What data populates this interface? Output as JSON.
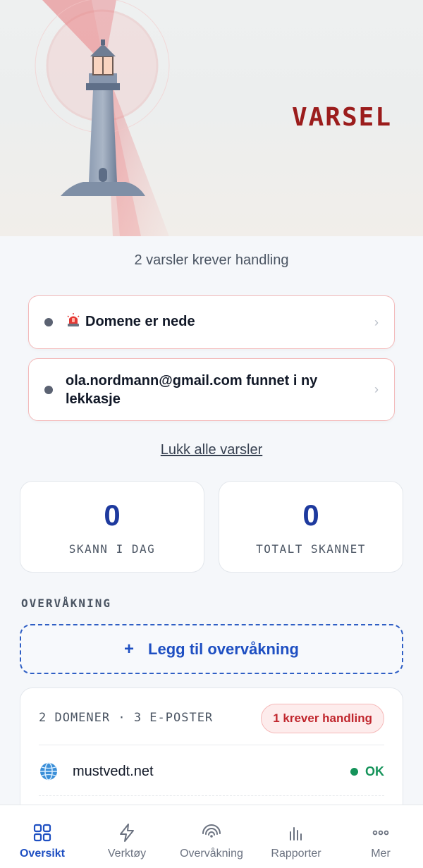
{
  "hero": {
    "title": "VARSEL"
  },
  "alerts": {
    "summary": "2 varsler krever handling",
    "items": [
      {
        "text": "Domene er nede",
        "icon": "siren-icon"
      },
      {
        "text": "ola.nordmann@gmail.com funnet i ny lekkasje"
      }
    ],
    "close_all": "Lukk alle varsler"
  },
  "stats": [
    {
      "value": "0",
      "label": "SKANN I DAG"
    },
    {
      "value": "0",
      "label": "TOTALT SKANNET"
    }
  ],
  "monitoring": {
    "section_label": "OVERVÅKNING",
    "add_button": "Legg til overvåkning",
    "add_icon": "+",
    "summary": "2 DOMENER · 3 E-POSTER",
    "badge": "1 krever handling",
    "rows": [
      {
        "domain": "mustvedt.net",
        "status": "OK"
      }
    ]
  },
  "nav": {
    "items": [
      {
        "label": "Oversikt",
        "icon": "grid-icon"
      },
      {
        "label": "Verktøy",
        "icon": "bolt-icon"
      },
      {
        "label": "Overvåkning",
        "icon": "radar-icon"
      },
      {
        "label": "Rapporter",
        "icon": "bar-chart-icon"
      },
      {
        "label": "Mer",
        "icon": "more-icon"
      }
    ]
  },
  "colors": {
    "accent": "#1e4fc2",
    "alert_red": "#9b1c1c",
    "ok_green": "#15935a"
  }
}
